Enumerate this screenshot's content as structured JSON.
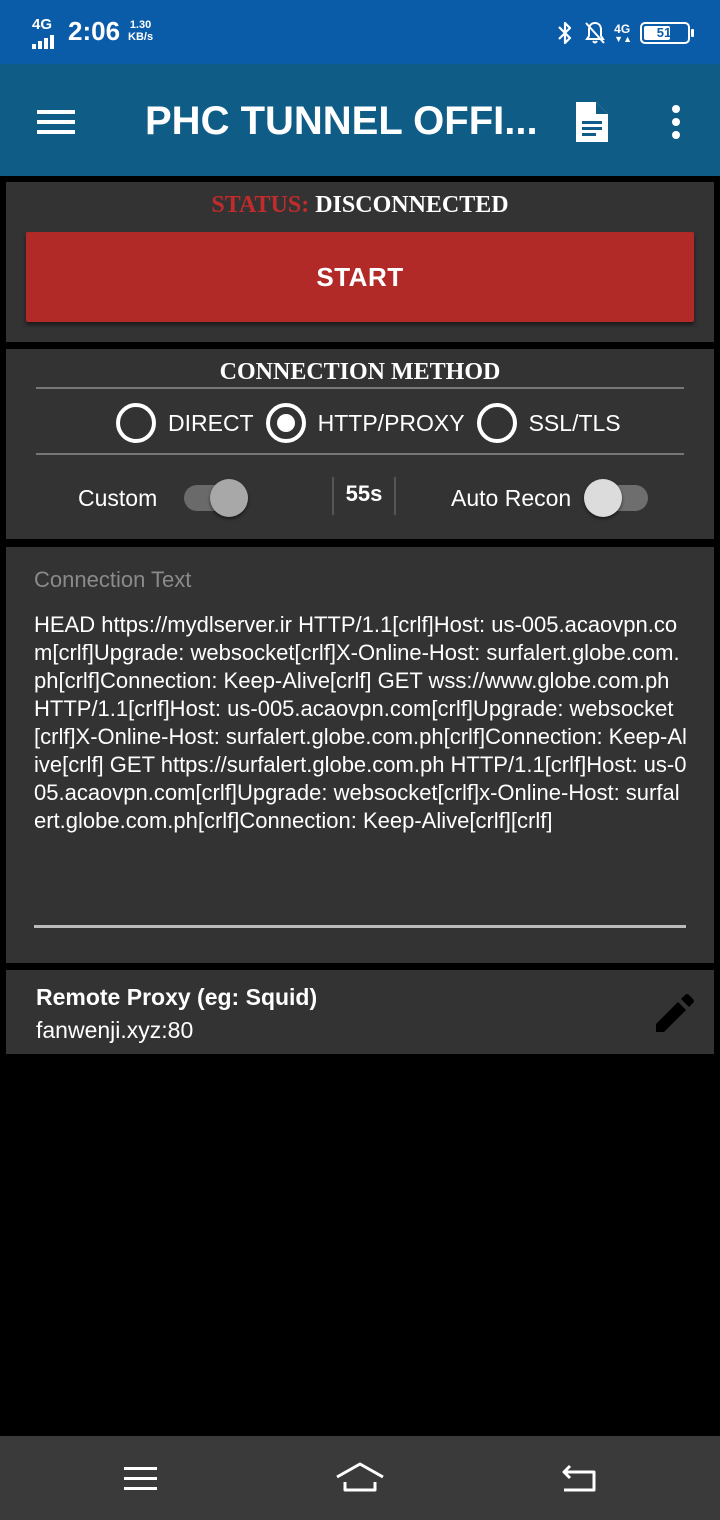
{
  "statusbar": {
    "network_label": "4G",
    "time": "2:06",
    "speed_value": "1.30",
    "speed_unit": "KB/s",
    "mobile_label": "4G",
    "battery": "51",
    "icons": [
      "bluetooth-icon",
      "notifications-off-icon",
      "battery-icon"
    ]
  },
  "appbar": {
    "title": "PHC TUNNEL OFFI...",
    "icons": [
      "menu-icon",
      "document-icon",
      "more-vert-icon"
    ]
  },
  "status": {
    "label": "STATUS:",
    "value": "DISCONNECTED",
    "label_color": "#c22b2b",
    "start_label": "START",
    "button_color": "#b22a27"
  },
  "method": {
    "title": "CONNECTION METHOD",
    "options": [
      {
        "label": "DIRECT",
        "selected": false
      },
      {
        "label": "HTTP/PROXY",
        "selected": true
      },
      {
        "label": "SSL/TLS",
        "selected": false
      }
    ],
    "custom_label": "Custom",
    "custom_on": false,
    "timer": "55s",
    "auto_label": "Auto Recon",
    "auto_on": false
  },
  "connection_text": {
    "label": "Connection Text",
    "value": "HEAD https://mydlserver.ir HTTP/1.1[crlf]Host: us-005.acaovpn.com[crlf]Upgrade: websocket[crlf]X-Online-Host: surfalert.globe.com.ph[crlf]Connection: Keep-Alive[crlf] GET wss://www.globe.com.ph HTTP/1.1[crlf]Host: us-005.acaovpn.com[crlf]Upgrade: websocket[crlf]X-Online-Host: surfalert.globe.com.ph[crlf]Connection: Keep-Alive[crlf] GET https://surfalert.globe.com.ph HTTP/1.1[crlf]Host: us-005.acaovpn.com[crlf]Upgrade: websocket[crlf]x-Online-Host: surfalert.globe.com.ph[crlf]Connection: Keep-Alive[crlf][crlf]"
  },
  "proxy": {
    "label": "Remote Proxy (eg: Squid)",
    "value": "fanwenji.xyz:80",
    "edit_icon": "pencil-icon"
  },
  "navbar": {
    "icons": [
      "nav-menu-icon",
      "nav-home-icon",
      "nav-back-icon"
    ]
  }
}
